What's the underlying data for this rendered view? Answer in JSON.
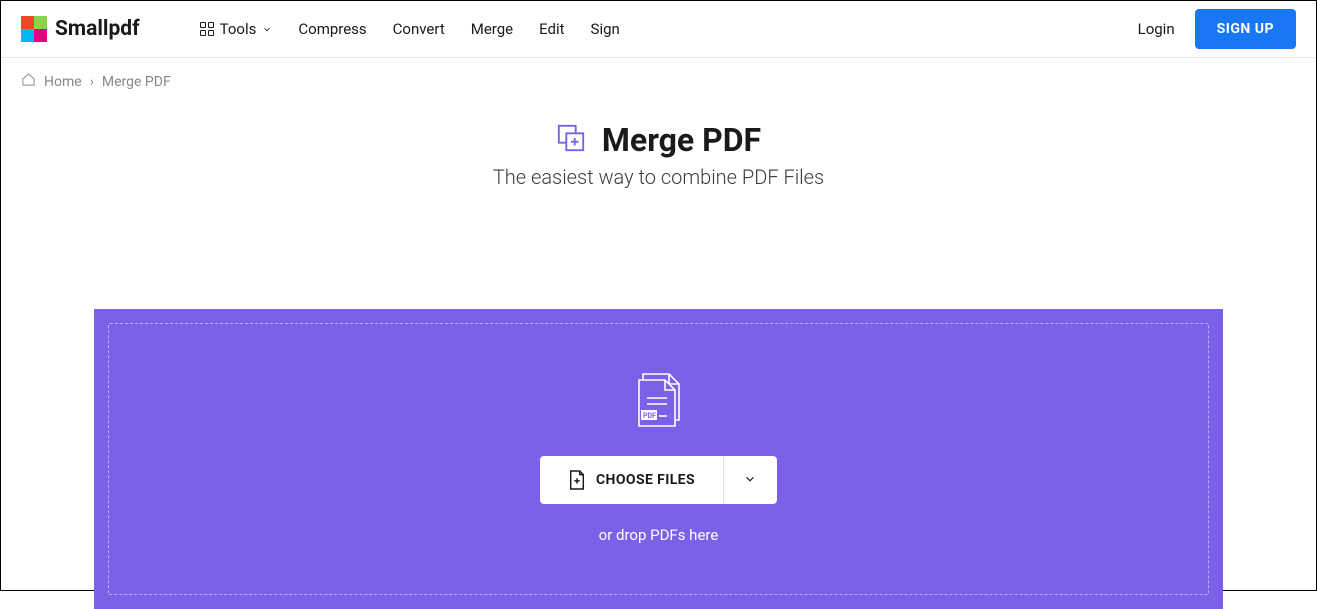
{
  "header": {
    "brand": "Smallpdf",
    "nav": {
      "tools": "Tools",
      "compress": "Compress",
      "convert": "Convert",
      "merge": "Merge",
      "edit": "Edit",
      "sign": "Sign"
    },
    "login": "Login",
    "signup": "SIGN UP"
  },
  "breadcrumb": {
    "home": "Home",
    "current": "Merge PDF"
  },
  "main": {
    "title": "Merge PDF",
    "subtitle": "The easiest way to combine PDF Files"
  },
  "dropzone": {
    "choose_label": "CHOOSE FILES",
    "drop_hint": "or drop PDFs here",
    "file_badge": "PDF"
  }
}
